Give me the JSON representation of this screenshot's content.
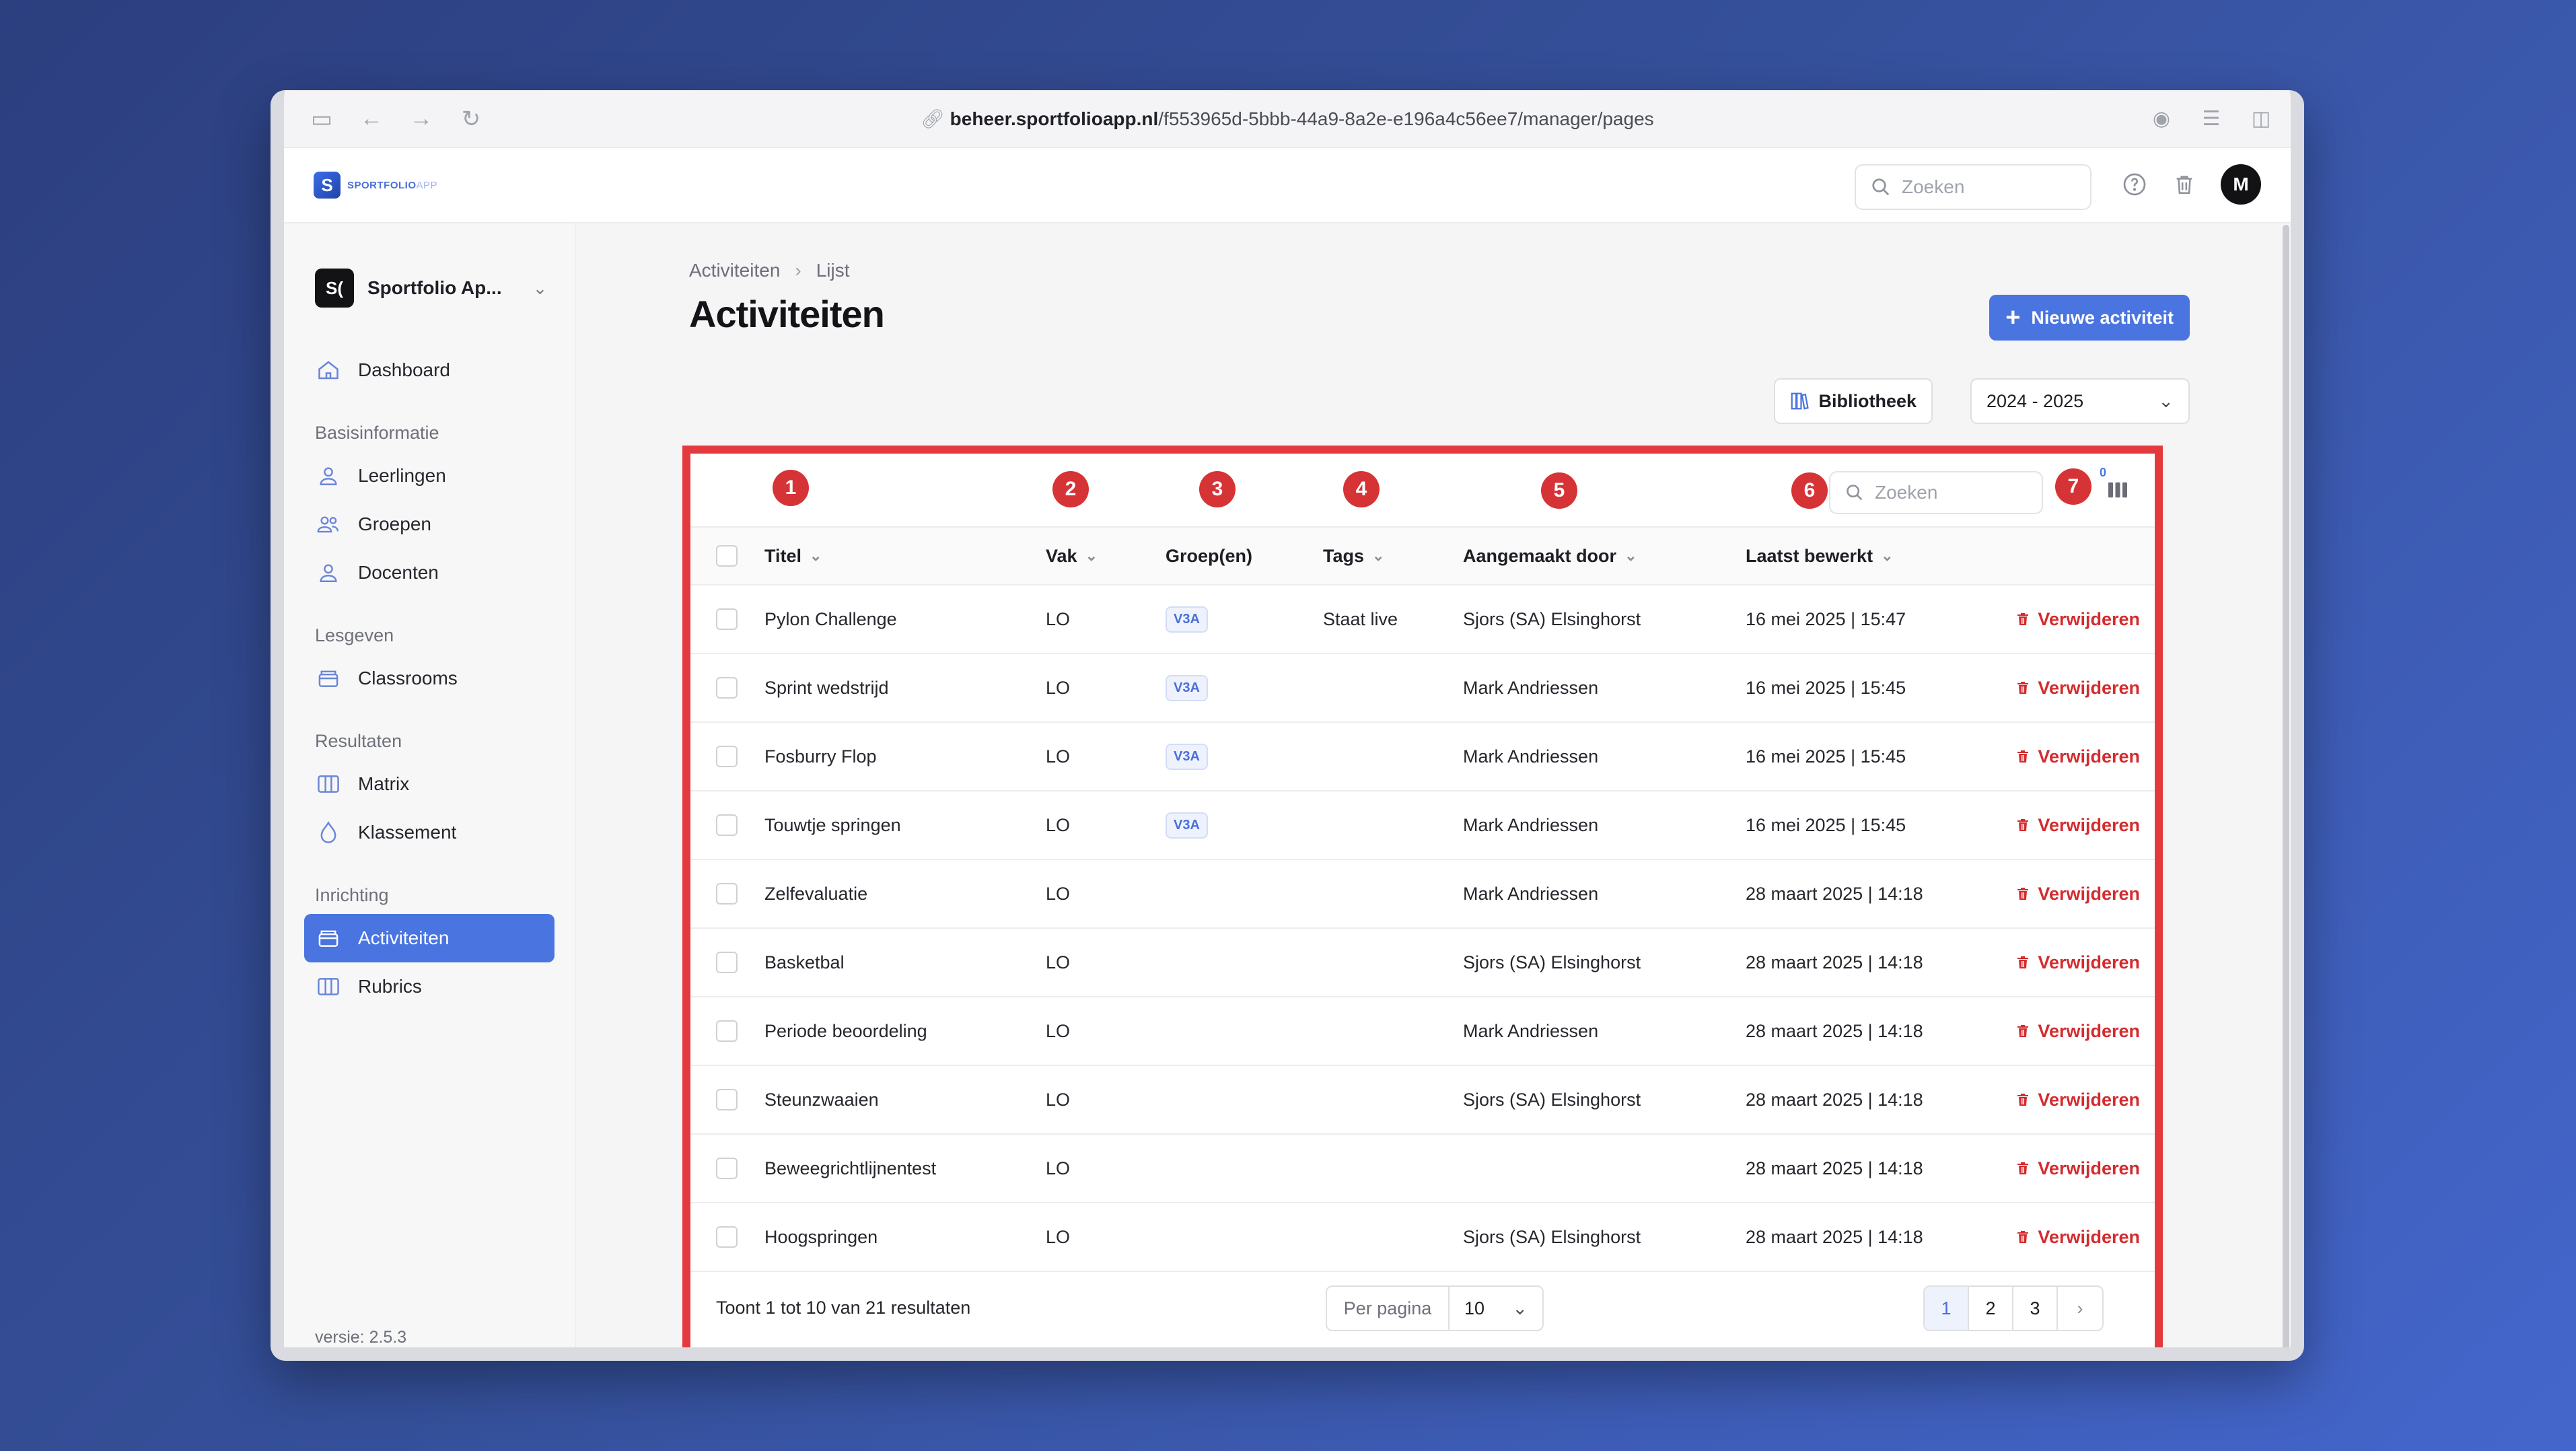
{
  "browser": {
    "url_host": "beheer.sportfolioapp.nl",
    "url_path": "/f553965d-5bbb-44a9-8a2e-e196a4c56ee7/manager/pages"
  },
  "topbar": {
    "logo_text": "SPORTFOLIO",
    "logo_suffix": "APP",
    "search_placeholder": "Zoeken",
    "avatar_initial": "M"
  },
  "sidebar": {
    "org_initials": "S(",
    "org_name": "Sportfolio Ap...",
    "dashboard": "Dashboard",
    "sections": {
      "basis": "Basisinformatie",
      "lesgeven": "Lesgeven",
      "resultaten": "Resultaten",
      "inrichting": "Inrichting"
    },
    "items": {
      "leerlingen": "Leerlingen",
      "groepen": "Groepen",
      "docenten": "Docenten",
      "classrooms": "Classrooms",
      "matrix": "Matrix",
      "klassement": "Klassement",
      "activiteiten": "Activiteiten",
      "rubrics": "Rubrics"
    },
    "version": "versie: 2.5.3"
  },
  "page": {
    "breadcrumb_1": "Activiteiten",
    "breadcrumb_2": "Lijst",
    "title": "Activiteiten",
    "new_button": "Nieuwe activiteit",
    "library_button": "Bibliotheek",
    "year_select": "2024 - 2025"
  },
  "annotations": [
    "1",
    "2",
    "3",
    "4",
    "5",
    "6",
    "7"
  ],
  "table": {
    "search_placeholder": "Zoeken",
    "columns_count": "0",
    "headers": {
      "titel": "Titel",
      "vak": "Vak",
      "groepen": "Groep(en)",
      "tags": "Tags",
      "aangemaakt": "Aangemaakt door",
      "bewerkt": "Laatst bewerkt"
    },
    "delete_label": "Verwijderen",
    "rows": [
      {
        "titel": "Pylon Challenge",
        "vak": "LO",
        "groep": "V3A",
        "tags": "Staat live",
        "door": "Sjors (SA) Elsinghorst",
        "bewerkt": "16 mei 2025 | 15:47"
      },
      {
        "titel": "Sprint wedstrijd",
        "vak": "LO",
        "groep": "V3A",
        "tags": "",
        "door": "Mark Andriessen",
        "bewerkt": "16 mei 2025 | 15:45"
      },
      {
        "titel": "Fosburry Flop",
        "vak": "LO",
        "groep": "V3A",
        "tags": "",
        "door": "Mark Andriessen",
        "bewerkt": "16 mei 2025 | 15:45"
      },
      {
        "titel": "Touwtje springen",
        "vak": "LO",
        "groep": "V3A",
        "tags": "",
        "door": "Mark Andriessen",
        "bewerkt": "16 mei 2025 | 15:45"
      },
      {
        "titel": "Zelfevaluatie",
        "vak": "LO",
        "groep": "",
        "tags": "",
        "door": "Mark Andriessen",
        "bewerkt": "28 maart 2025 | 14:18"
      },
      {
        "titel": "Basketbal",
        "vak": "LO",
        "groep": "",
        "tags": "",
        "door": "Sjors (SA) Elsinghorst",
        "bewerkt": "28 maart 2025 | 14:18"
      },
      {
        "titel": "Periode beoordeling",
        "vak": "LO",
        "groep": "",
        "tags": "",
        "door": "Mark Andriessen",
        "bewerkt": "28 maart 2025 | 14:18"
      },
      {
        "titel": "Steunzwaaien",
        "vak": "LO",
        "groep": "",
        "tags": "",
        "door": "Sjors (SA) Elsinghorst",
        "bewerkt": "28 maart 2025 | 14:18"
      },
      {
        "titel": "Beweegrichtlijnentest",
        "vak": "LO",
        "groep": "",
        "tags": "",
        "door": "",
        "bewerkt": "28 maart 2025 | 14:18"
      },
      {
        "titel": "Hoogspringen",
        "vak": "LO",
        "groep": "",
        "tags": "",
        "door": "Sjors (SA) Elsinghorst",
        "bewerkt": "28 maart 2025 | 14:18"
      }
    ],
    "footer": {
      "results": "Toont 1 tot 10 van 21 resultaten",
      "per_page_label": "Per pagina",
      "per_page_value": "10",
      "pages": [
        "1",
        "2",
        "3"
      ],
      "next": "›"
    }
  },
  "colors": {
    "accent": "#4a74e0",
    "danger": "#d42b2e",
    "highlight_border": "#e53a3d"
  }
}
